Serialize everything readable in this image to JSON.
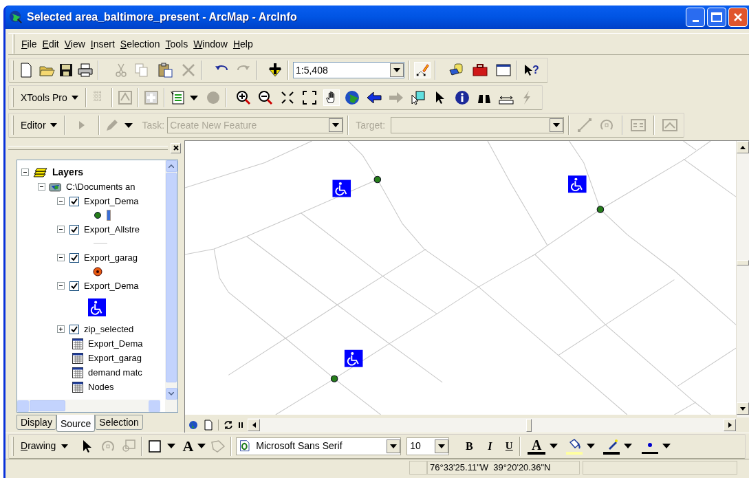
{
  "window": {
    "title": "Selected area_baltimore_present - ArcMap - ArcInfo"
  },
  "menu": [
    "File",
    "Edit",
    "View",
    "Insert",
    "Selection",
    "Tools",
    "Window",
    "Help"
  ],
  "standard_toolbar": {
    "scale": "1:5,408",
    "whats_this": "?"
  },
  "xtools_toolbar": {
    "label": "XTools Pro"
  },
  "editor_toolbar": {
    "label": "Editor",
    "task_label": "Task:",
    "task_value": "Create New Feature",
    "target_label": "Target:",
    "disabled": true
  },
  "toc": {
    "root": {
      "label": "Layers",
      "expanded": true
    },
    "frame": {
      "label": "C:\\Documents an",
      "expanded": true
    },
    "items": [
      {
        "kind": "layer",
        "label": "Export_Dema",
        "checked": true,
        "expanded": true,
        "legend": {
          "kind": "node"
        }
      },
      {
        "kind": "layer",
        "label": "Export_Allstre",
        "checked": true,
        "expanded": true,
        "legend": {
          "kind": "street"
        }
      },
      {
        "kind": "layer",
        "label": "Export_garag",
        "checked": true,
        "expanded": true,
        "legend": {
          "kind": "garage"
        }
      },
      {
        "kind": "layer",
        "label": "Export_Dema",
        "checked": true,
        "expanded": true,
        "legend": {
          "kind": "accessible"
        }
      },
      {
        "kind": "layer",
        "label": "zip_selected",
        "checked": true,
        "expanded": false
      },
      {
        "kind": "table",
        "label": "Export_Dema"
      },
      {
        "kind": "table",
        "label": "Export_garag"
      },
      {
        "kind": "table",
        "label": "demand matc"
      },
      {
        "kind": "table",
        "label": "Nodes"
      }
    ],
    "tabs": [
      {
        "label": "Display",
        "selected": false
      },
      {
        "label": "Source",
        "selected": true
      },
      {
        "label": "Selection",
        "selected": false
      }
    ]
  },
  "drawing_toolbar": {
    "label": "Drawing",
    "text_tool": "A",
    "font": "Microsoft Sans Serif",
    "size": "10",
    "bold": "B",
    "italic": "I",
    "underline": "U",
    "font_color": "A"
  },
  "status_bar": {
    "coordinates": "76°33'25.11\"W  39°20'20.36\"N"
  }
}
